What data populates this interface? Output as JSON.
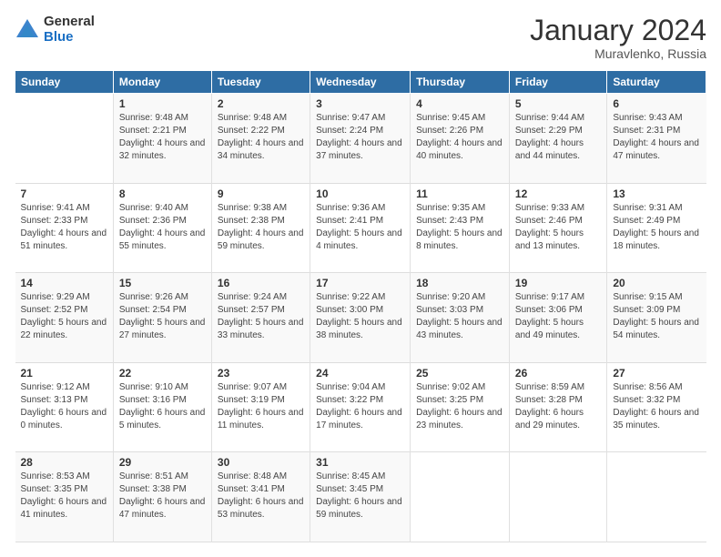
{
  "logo": {
    "general": "General",
    "blue": "Blue"
  },
  "header": {
    "month": "January 2024",
    "location": "Muravlenko, Russia"
  },
  "days": [
    "Sunday",
    "Monday",
    "Tuesday",
    "Wednesday",
    "Thursday",
    "Friday",
    "Saturday"
  ],
  "weeks": [
    [
      {
        "day": "",
        "sunrise": "",
        "sunset": "",
        "daylight": ""
      },
      {
        "day": "1",
        "sunrise": "Sunrise: 9:48 AM",
        "sunset": "Sunset: 2:21 PM",
        "daylight": "Daylight: 4 hours and 32 minutes."
      },
      {
        "day": "2",
        "sunrise": "Sunrise: 9:48 AM",
        "sunset": "Sunset: 2:22 PM",
        "daylight": "Daylight: 4 hours and 34 minutes."
      },
      {
        "day": "3",
        "sunrise": "Sunrise: 9:47 AM",
        "sunset": "Sunset: 2:24 PM",
        "daylight": "Daylight: 4 hours and 37 minutes."
      },
      {
        "day": "4",
        "sunrise": "Sunrise: 9:45 AM",
        "sunset": "Sunset: 2:26 PM",
        "daylight": "Daylight: 4 hours and 40 minutes."
      },
      {
        "day": "5",
        "sunrise": "Sunrise: 9:44 AM",
        "sunset": "Sunset: 2:29 PM",
        "daylight": "Daylight: 4 hours and 44 minutes."
      },
      {
        "day": "6",
        "sunrise": "Sunrise: 9:43 AM",
        "sunset": "Sunset: 2:31 PM",
        "daylight": "Daylight: 4 hours and 47 minutes."
      }
    ],
    [
      {
        "day": "7",
        "sunrise": "Sunrise: 9:41 AM",
        "sunset": "Sunset: 2:33 PM",
        "daylight": "Daylight: 4 hours and 51 minutes."
      },
      {
        "day": "8",
        "sunrise": "Sunrise: 9:40 AM",
        "sunset": "Sunset: 2:36 PM",
        "daylight": "Daylight: 4 hours and 55 minutes."
      },
      {
        "day": "9",
        "sunrise": "Sunrise: 9:38 AM",
        "sunset": "Sunset: 2:38 PM",
        "daylight": "Daylight: 4 hours and 59 minutes."
      },
      {
        "day": "10",
        "sunrise": "Sunrise: 9:36 AM",
        "sunset": "Sunset: 2:41 PM",
        "daylight": "Daylight: 5 hours and 4 minutes."
      },
      {
        "day": "11",
        "sunrise": "Sunrise: 9:35 AM",
        "sunset": "Sunset: 2:43 PM",
        "daylight": "Daylight: 5 hours and 8 minutes."
      },
      {
        "day": "12",
        "sunrise": "Sunrise: 9:33 AM",
        "sunset": "Sunset: 2:46 PM",
        "daylight": "Daylight: 5 hours and 13 minutes."
      },
      {
        "day": "13",
        "sunrise": "Sunrise: 9:31 AM",
        "sunset": "Sunset: 2:49 PM",
        "daylight": "Daylight: 5 hours and 18 minutes."
      }
    ],
    [
      {
        "day": "14",
        "sunrise": "Sunrise: 9:29 AM",
        "sunset": "Sunset: 2:52 PM",
        "daylight": "Daylight: 5 hours and 22 minutes."
      },
      {
        "day": "15",
        "sunrise": "Sunrise: 9:26 AM",
        "sunset": "Sunset: 2:54 PM",
        "daylight": "Daylight: 5 hours and 27 minutes."
      },
      {
        "day": "16",
        "sunrise": "Sunrise: 9:24 AM",
        "sunset": "Sunset: 2:57 PM",
        "daylight": "Daylight: 5 hours and 33 minutes."
      },
      {
        "day": "17",
        "sunrise": "Sunrise: 9:22 AM",
        "sunset": "Sunset: 3:00 PM",
        "daylight": "Daylight: 5 hours and 38 minutes."
      },
      {
        "day": "18",
        "sunrise": "Sunrise: 9:20 AM",
        "sunset": "Sunset: 3:03 PM",
        "daylight": "Daylight: 5 hours and 43 minutes."
      },
      {
        "day": "19",
        "sunrise": "Sunrise: 9:17 AM",
        "sunset": "Sunset: 3:06 PM",
        "daylight": "Daylight: 5 hours and 49 minutes."
      },
      {
        "day": "20",
        "sunrise": "Sunrise: 9:15 AM",
        "sunset": "Sunset: 3:09 PM",
        "daylight": "Daylight: 5 hours and 54 minutes."
      }
    ],
    [
      {
        "day": "21",
        "sunrise": "Sunrise: 9:12 AM",
        "sunset": "Sunset: 3:13 PM",
        "daylight": "Daylight: 6 hours and 0 minutes."
      },
      {
        "day": "22",
        "sunrise": "Sunrise: 9:10 AM",
        "sunset": "Sunset: 3:16 PM",
        "daylight": "Daylight: 6 hours and 5 minutes."
      },
      {
        "day": "23",
        "sunrise": "Sunrise: 9:07 AM",
        "sunset": "Sunset: 3:19 PM",
        "daylight": "Daylight: 6 hours and 11 minutes."
      },
      {
        "day": "24",
        "sunrise": "Sunrise: 9:04 AM",
        "sunset": "Sunset: 3:22 PM",
        "daylight": "Daylight: 6 hours and 17 minutes."
      },
      {
        "day": "25",
        "sunrise": "Sunrise: 9:02 AM",
        "sunset": "Sunset: 3:25 PM",
        "daylight": "Daylight: 6 hours and 23 minutes."
      },
      {
        "day": "26",
        "sunrise": "Sunrise: 8:59 AM",
        "sunset": "Sunset: 3:28 PM",
        "daylight": "Daylight: 6 hours and 29 minutes."
      },
      {
        "day": "27",
        "sunrise": "Sunrise: 8:56 AM",
        "sunset": "Sunset: 3:32 PM",
        "daylight": "Daylight: 6 hours and 35 minutes."
      }
    ],
    [
      {
        "day": "28",
        "sunrise": "Sunrise: 8:53 AM",
        "sunset": "Sunset: 3:35 PM",
        "daylight": "Daylight: 6 hours and 41 minutes."
      },
      {
        "day": "29",
        "sunrise": "Sunrise: 8:51 AM",
        "sunset": "Sunset: 3:38 PM",
        "daylight": "Daylight: 6 hours and 47 minutes."
      },
      {
        "day": "30",
        "sunrise": "Sunrise: 8:48 AM",
        "sunset": "Sunset: 3:41 PM",
        "daylight": "Daylight: 6 hours and 53 minutes."
      },
      {
        "day": "31",
        "sunrise": "Sunrise: 8:45 AM",
        "sunset": "Sunset: 3:45 PM",
        "daylight": "Daylight: 6 hours and 59 minutes."
      },
      {
        "day": "",
        "sunrise": "",
        "sunset": "",
        "daylight": ""
      },
      {
        "day": "",
        "sunrise": "",
        "sunset": "",
        "daylight": ""
      },
      {
        "day": "",
        "sunrise": "",
        "sunset": "",
        "daylight": ""
      }
    ]
  ]
}
